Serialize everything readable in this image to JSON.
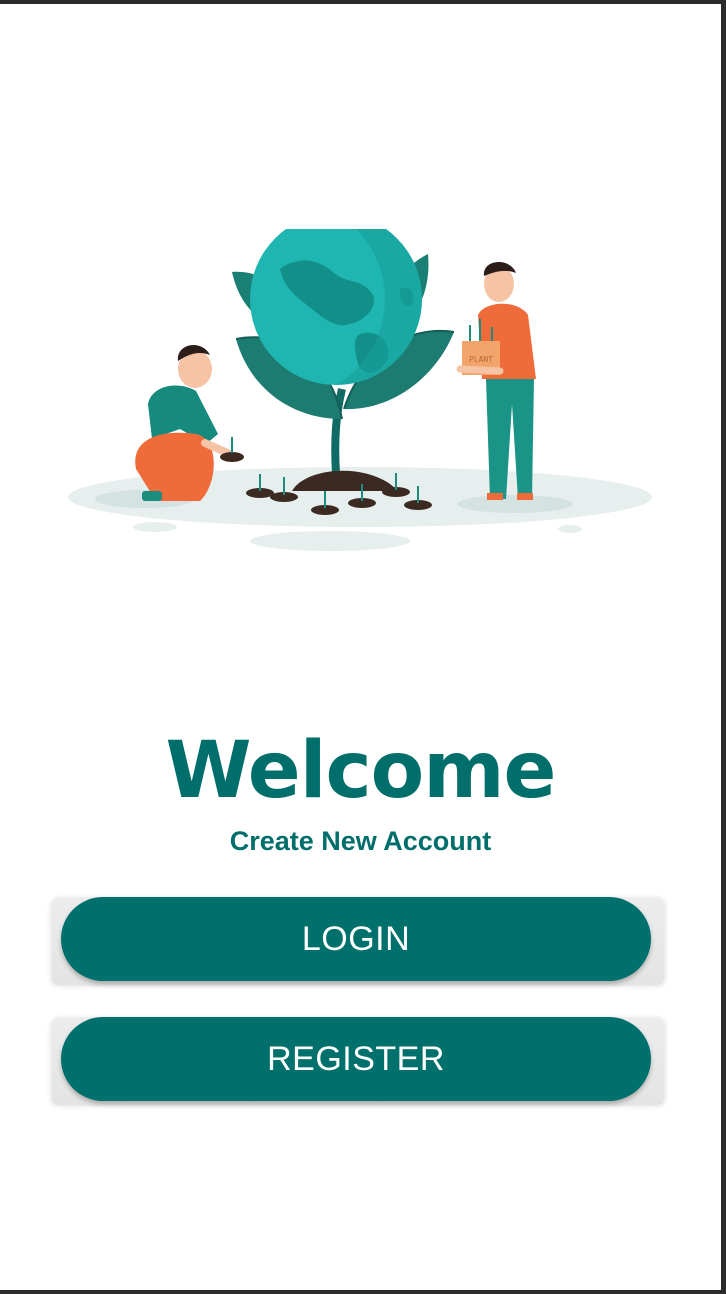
{
  "welcome": {
    "title": "Welcome",
    "subtitle": "Create New Account"
  },
  "illustration": {
    "box_label": "PLANT"
  },
  "actions": {
    "login_label": "LOGIN",
    "register_label": "REGISTER"
  },
  "colors": {
    "primary": "#00706c",
    "title": "#006e6b",
    "accent_orange": "#ef6b3a",
    "globe": "#1fb5b0"
  }
}
